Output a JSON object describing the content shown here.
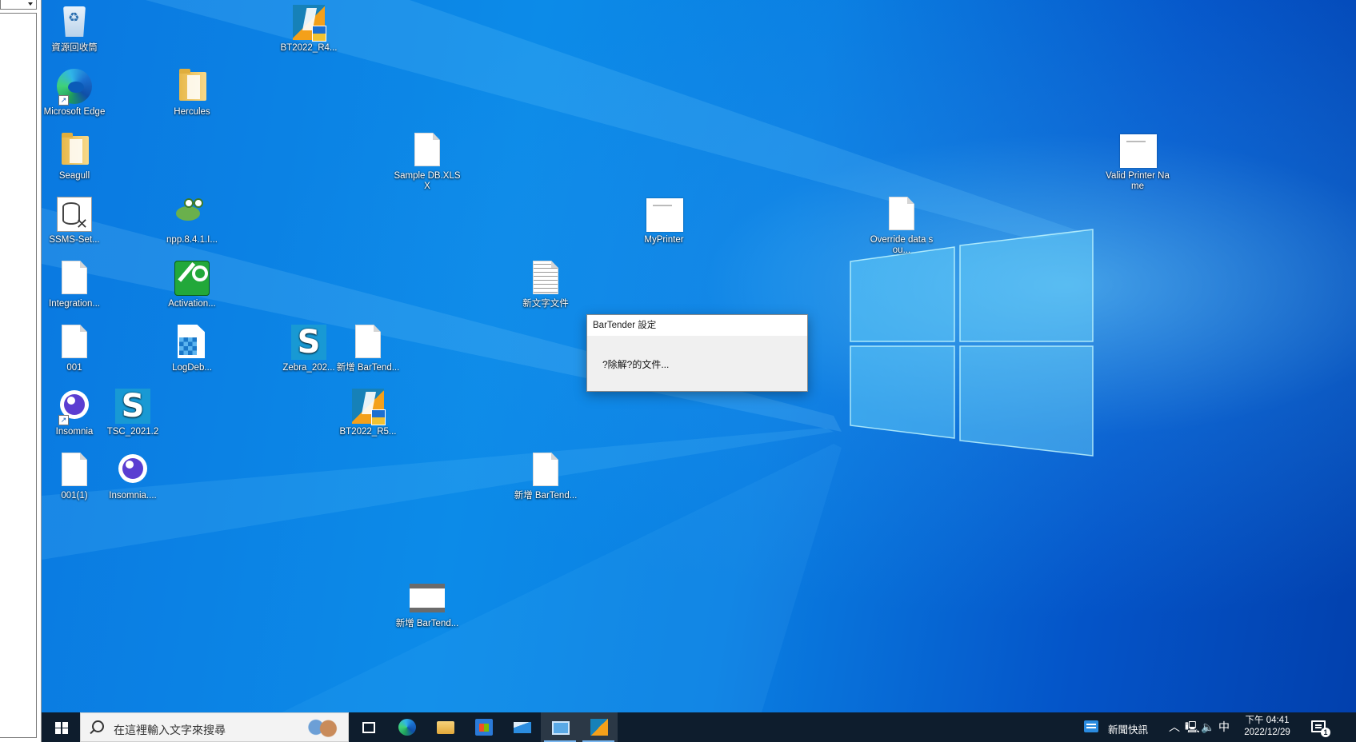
{
  "desktop_icons": [
    {
      "label": "資源回收筒",
      "icon": "recycle-bin-icon"
    },
    {
      "label": "BT2022_R4...",
      "icon": "bartender-installer-icon"
    },
    {
      "label": "Microsoft Edge",
      "icon": "edge-icon"
    },
    {
      "label": "Hercules",
      "icon": "folder-icon"
    },
    {
      "label": "Seagull",
      "icon": "folder-icon"
    },
    {
      "label": "Sample DB.XLSX",
      "icon": "document-icon"
    },
    {
      "label": "Valid Printer Name",
      "icon": "document-thumbnail-icon"
    },
    {
      "label": "SSMS-Set...",
      "icon": "ssms-setup-icon"
    },
    {
      "label": "npp.8.4.1.I...",
      "icon": "notepad-plus-plus-icon"
    },
    {
      "label": "MyPrinter",
      "icon": "document-thumbnail-icon"
    },
    {
      "label": "Override data sou...",
      "icon": "document-icon"
    },
    {
      "label": "Integration...",
      "icon": "document-icon"
    },
    {
      "label": "Activation...",
      "icon": "activation-key-icon"
    },
    {
      "label": "新文字文件",
      "icon": "text-file-icon"
    },
    {
      "label": "001",
      "icon": "document-icon"
    },
    {
      "label": "LogDeb...",
      "icon": "log-debug-icon"
    },
    {
      "label": "Zebra_202...",
      "icon": "seagull-driver-icon"
    },
    {
      "label": "新增 BarTend...",
      "icon": "document-icon"
    },
    {
      "label": "Insomnia",
      "icon": "insomnia-icon"
    },
    {
      "label": "TSC_2021.2",
      "icon": "seagull-driver-icon"
    },
    {
      "label": "BT2022_R5...",
      "icon": "bartender-installer-icon"
    },
    {
      "label": "001(1)",
      "icon": "document-icon"
    },
    {
      "label": "Insomnia....",
      "icon": "insomnia-icon"
    },
    {
      "label": "新增 BarTend...",
      "icon": "document-icon"
    },
    {
      "label": "新增 BarTend...",
      "icon": "window-thumbnail-icon"
    }
  ],
  "dialog": {
    "title": "BarTender 設定",
    "message": "?除解?的文件..."
  },
  "taskbar": {
    "search_placeholder": "在這裡輸入文字來搜尋",
    "apps": [
      "task-view-icon",
      "edge-icon",
      "file-explorer-icon",
      "store-icon",
      "mail-icon",
      "remote-desktop-icon",
      "bartender-icon"
    ],
    "active_app": "bartender-icon",
    "news_label": "新聞快訊",
    "ime": "中",
    "time": "下午 04:41",
    "date": "2022/12/29",
    "notification_count": "1"
  }
}
